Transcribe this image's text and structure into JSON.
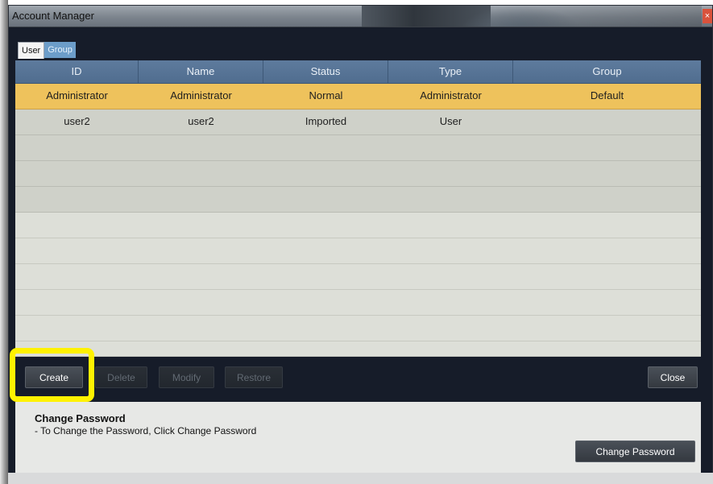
{
  "window": {
    "title": "Account Manager",
    "close_glyph": "×"
  },
  "tabs": [
    {
      "label": "User",
      "active": true
    },
    {
      "label": "Group",
      "active": false
    }
  ],
  "grid": {
    "columns": [
      "ID",
      "Name",
      "Status",
      "Type",
      "Group"
    ],
    "rows": [
      {
        "id": "Administrator",
        "name": "Administrator",
        "status": "Normal",
        "type": "Administrator",
        "group": "Default",
        "selected": true
      },
      {
        "id": "user2",
        "name": "user2",
        "status": "Imported",
        "type": "User",
        "group": "",
        "selected": false
      }
    ]
  },
  "buttons": {
    "create": "Create",
    "delete": "Delete",
    "modify": "Modify",
    "restore": "Restore",
    "close": "Close",
    "change_password": "Change Password"
  },
  "info": {
    "title": "Change Password",
    "description": "- To Change the Password, Click Change Password"
  },
  "colors": {
    "selected_row": "#eec25c",
    "header": "#5e7b9d",
    "highlight": "#fff200"
  }
}
